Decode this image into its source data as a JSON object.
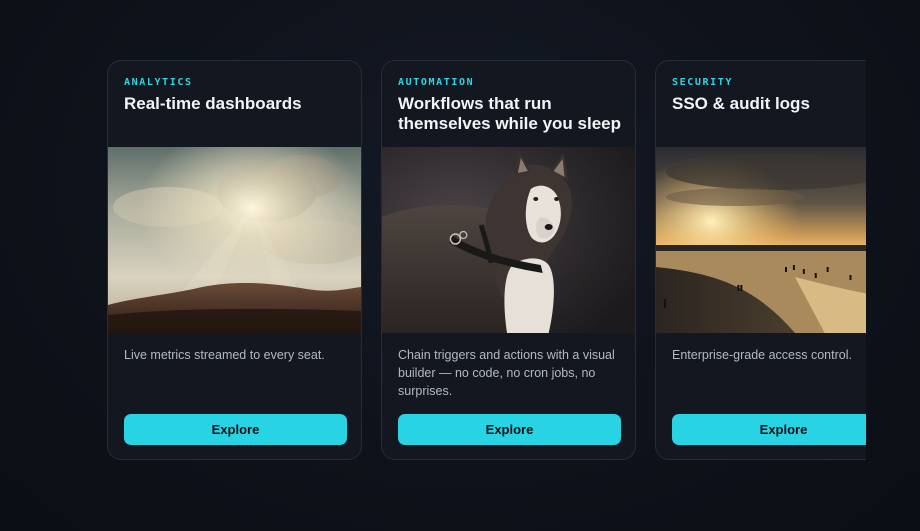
{
  "carousel": {
    "cards": [
      {
        "category": "ANALYTICS",
        "title": "Real-time dashboards",
        "image": "desert-sky-sunbeams",
        "description": "Live metrics streamed to every seat.",
        "button_label": "Explore"
      },
      {
        "category": "AUTOMATION",
        "title": "Workflows that run themselves while you sleep",
        "image": "husky-dog-portrait",
        "description": "Chain triggers and actions with a visual builder — no code, no cron jobs, no surprises.",
        "button_label": "Explore"
      },
      {
        "category": "SECURITY",
        "title": "SSO & audit logs",
        "image": "beach-sunset",
        "description": "Enterprise-grade access control.",
        "button_label": "Explore"
      }
    ]
  },
  "colors": {
    "background": "#0e121a",
    "card": "#13171f",
    "accent": "#28d4e4"
  }
}
